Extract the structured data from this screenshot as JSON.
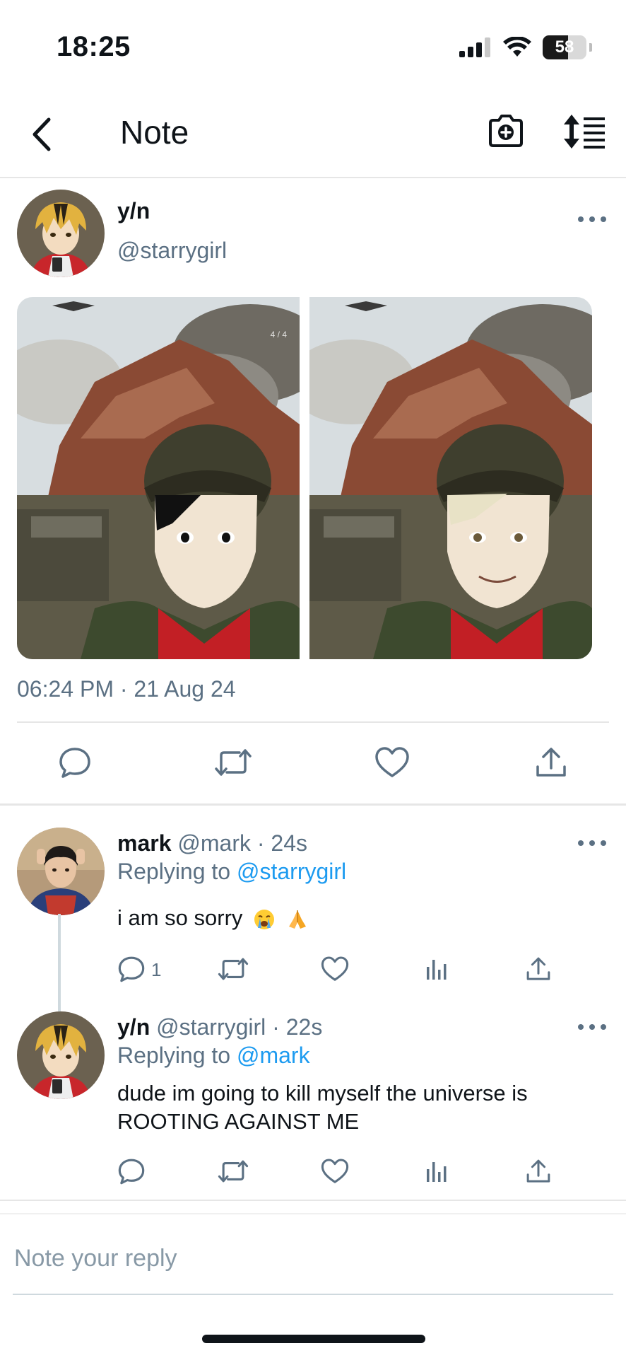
{
  "status_bar": {
    "time": "18:25",
    "battery": "58",
    "battery_level_percent": 58,
    "icons": [
      "signal-icon",
      "wifi-icon",
      "battery-icon"
    ]
  },
  "header": {
    "title": "Note",
    "icons": [
      "back-chevron-icon",
      "camera-plus-icon",
      "sort-list-icon"
    ]
  },
  "post": {
    "author_name": "y/n",
    "author_handle": "@starrygirl",
    "image_counter": "4 / 4",
    "timestamp": "06:24 PM · 21 Aug 24",
    "actions": [
      "reply-icon",
      "retweet-icon",
      "like-icon",
      "share-icon"
    ]
  },
  "replies": [
    {
      "name": "mark",
      "handle": "@mark",
      "time": "· 24s",
      "replying_prefix": "Replying to",
      "replying_to": "@starrygirl",
      "text": "i am so sorry",
      "emojis": [
        "crying-face-emoji",
        "folded-hands-emoji"
      ],
      "reply_count": "1"
    },
    {
      "name": "y/n",
      "handle": "@starrygirl",
      "time": "· 22s",
      "replying_prefix": "Replying to",
      "replying_to": "@mark",
      "text_line1": "dude im going to kill myself the universe is",
      "text_line2": "ROOTING AGAINST ME",
      "reply_count": ""
    }
  ],
  "reply_box": {
    "placeholder": "Note your reply"
  },
  "colors": {
    "text": "#0f1419",
    "secondary": "#5b7083",
    "link": "#1d9bf0",
    "divider": "#e6e6e6"
  }
}
